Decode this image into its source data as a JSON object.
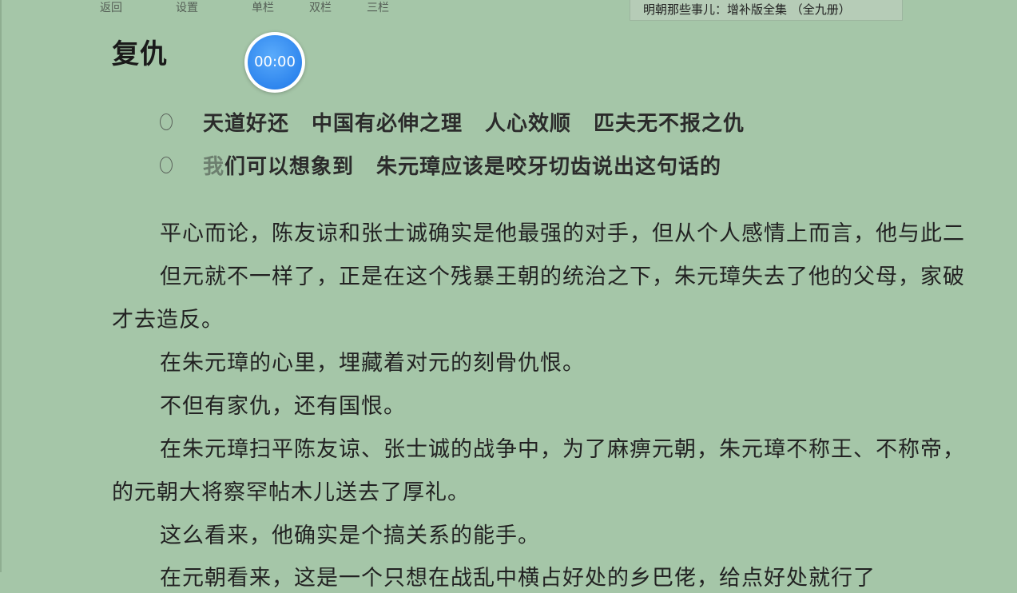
{
  "toolbar": {
    "back": "返回",
    "settings": "设置",
    "single_column": "单栏",
    "double_column": "双栏",
    "triple_column": "三栏"
  },
  "book_title": "明朝那些事儿：增补版全集 （全九册）",
  "chapter_title": "复仇",
  "timer": "00:00",
  "quotes": [
    {
      "parts": [
        "天道好还",
        "中国有必伸之理",
        "人心效顺",
        "匹夫无不报之仇"
      ]
    },
    {
      "first_char": "我",
      "part1_rest": "们可以想象到",
      "part2": "朱元璋应该是咬牙切齿说出这句话的"
    }
  ],
  "paragraphs": [
    "平心而论，陈友谅和张士诚确实是他最强的对手，但从个人感情上而言，他与此二",
    "但元就不一样了，正是在这个残暴王朝的统治之下，朱元璋失去了他的父母，家破",
    "才去造反。",
    "在朱元璋的心里，埋藏着对元的刻骨仇恨。",
    "不但有家仇，还有国恨。",
    "在朱元璋扫平陈友谅、张士诚的战争中，为了麻痹元朝，朱元璋不称王、不称帝，",
    "的元朝大将察罕帖木儿送去了厚礼。",
    "这么看来，他确实是个搞关系的能手。",
    "在元朝看来，这是一个只想在战乱中横占好处的乡巴佬，给点好处就行了"
  ],
  "colors": {
    "background": "#a5c6a8",
    "timer_blue": "#2f86ee"
  }
}
